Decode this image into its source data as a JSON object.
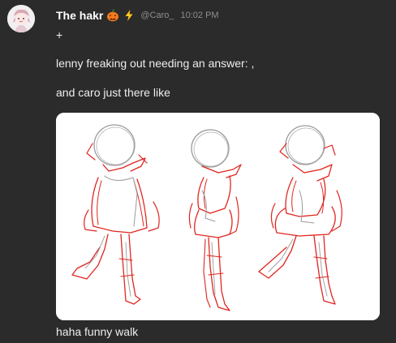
{
  "post": {
    "author": "The hakr",
    "author_emojis": [
      "jack-o-lantern-icon",
      "lightning-bolt-icon"
    ],
    "handle": "@Caro_",
    "timestamp": "10:02 PM",
    "lines": [
      "+",
      "lenny freaking out needing an answer: ,",
      "and caro just there like",
      "haha funny walk"
    ],
    "attachment_icon": "walking-figures-sketch"
  },
  "colors": {
    "background": "#2b2b2b",
    "text": "#eeeeee",
    "muted": "#8e8e8e",
    "sketch_red": "#e0251f",
    "sketch_gray": "#9a9a9a"
  }
}
